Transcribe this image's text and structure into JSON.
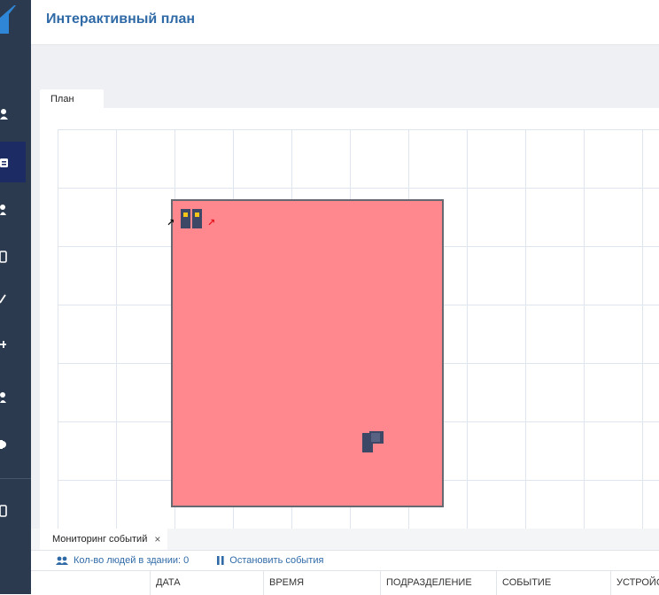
{
  "app": {
    "title": "Интерактивный план"
  },
  "sidebar": {
    "icons": [
      "person-icon",
      "card-icon",
      "users-icon",
      "badge-icon",
      "check-icon",
      "plus-icon",
      "group-icon",
      "gear-icon",
      "exit-icon"
    ]
  },
  "plan": {
    "tab_label": "План",
    "devices": [
      "controller-icon",
      "reader-icon",
      "entry-arrow-icon",
      "exit-arrow-icon"
    ]
  },
  "monitor": {
    "tab_label": "Мониторинг событий",
    "close_glyph": "×",
    "people_count_label": "Кол-во людей в здании: 0",
    "stop_label": "Остановить события",
    "columns": [
      "ДАТА",
      "ВРЕМЯ",
      "ПОДРАЗДЕЛЕНИЕ",
      "СОБЫТИЕ",
      "УСТРОЙС"
    ]
  },
  "colors": {
    "sidebar": "#2c3a4f",
    "sidebar_active": "#1d2b64",
    "accent": "#2f6aa7",
    "room_fill": "#ff878e",
    "room_border": "#666a70",
    "device": "#3d4766",
    "device_led": "#f5c518",
    "arrow_in": "#111111",
    "arrow_out": "#e8141e"
  }
}
